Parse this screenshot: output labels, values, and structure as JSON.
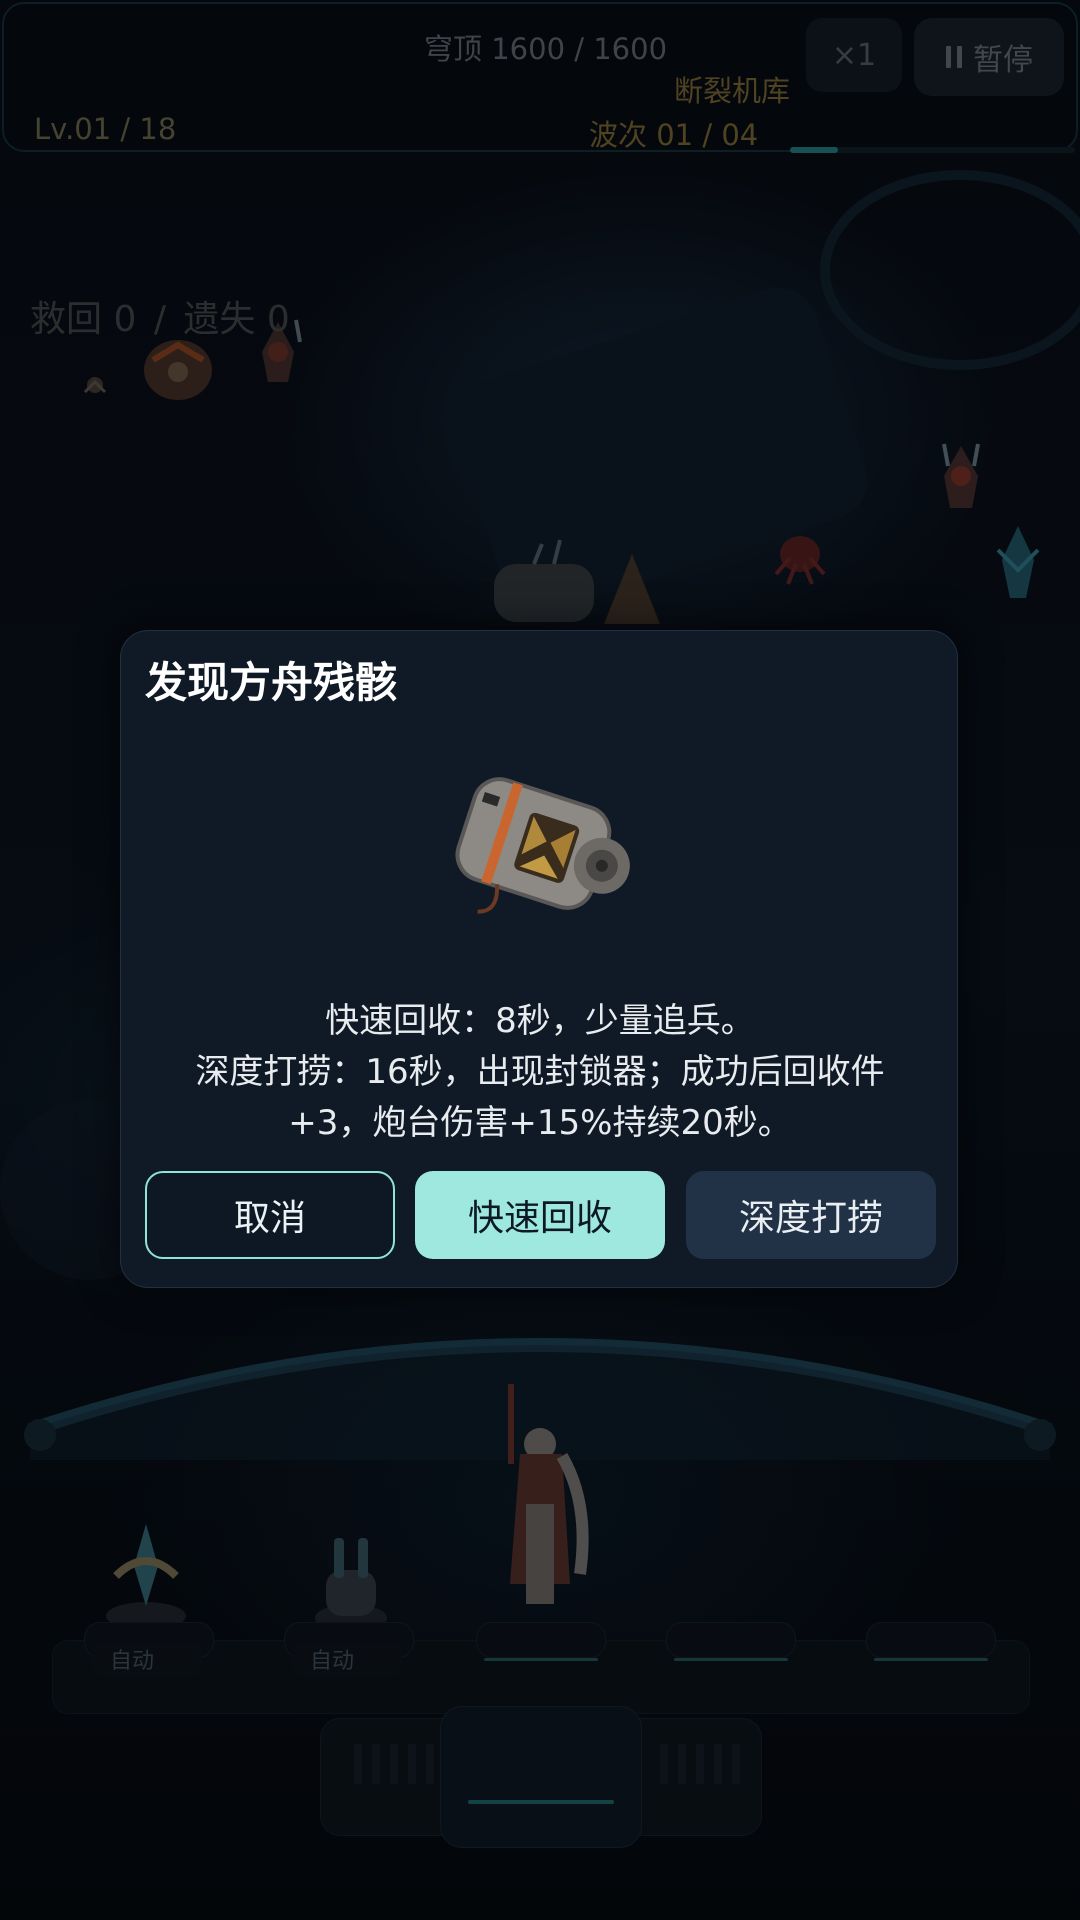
{
  "hud": {
    "hp": "穹顶 1600 / 1600",
    "zone": "断裂机库",
    "level": "Lv.01 / 18",
    "wave": "波次  01 / 04",
    "speed_label": "×1",
    "pause_label": "暂停",
    "wave_progress_fraction": 0.17
  },
  "rescue": {
    "saved_label": "救回 0",
    "separator": "/",
    "lost_label": "遗失 0"
  },
  "dialog": {
    "title": "发现方舟残骸",
    "description_lines": [
      "快速回收：8秒，少量追兵。",
      "深度打捞：16秒，出现封锁器；成功后回收件",
      "+3，炮台伤害+15%持续20秒。"
    ],
    "cancel_label": "取消",
    "quick_label": "快速回收",
    "deep_label": "深度打捞"
  },
  "slots": {
    "slot1_mode": "自动",
    "slot2_mode": "自动"
  },
  "colors": {
    "accent": "#9fe8df",
    "dialog_bg": "#101a27",
    "secondary_button": "#223246",
    "hud_gold": "#6b5a2d"
  }
}
